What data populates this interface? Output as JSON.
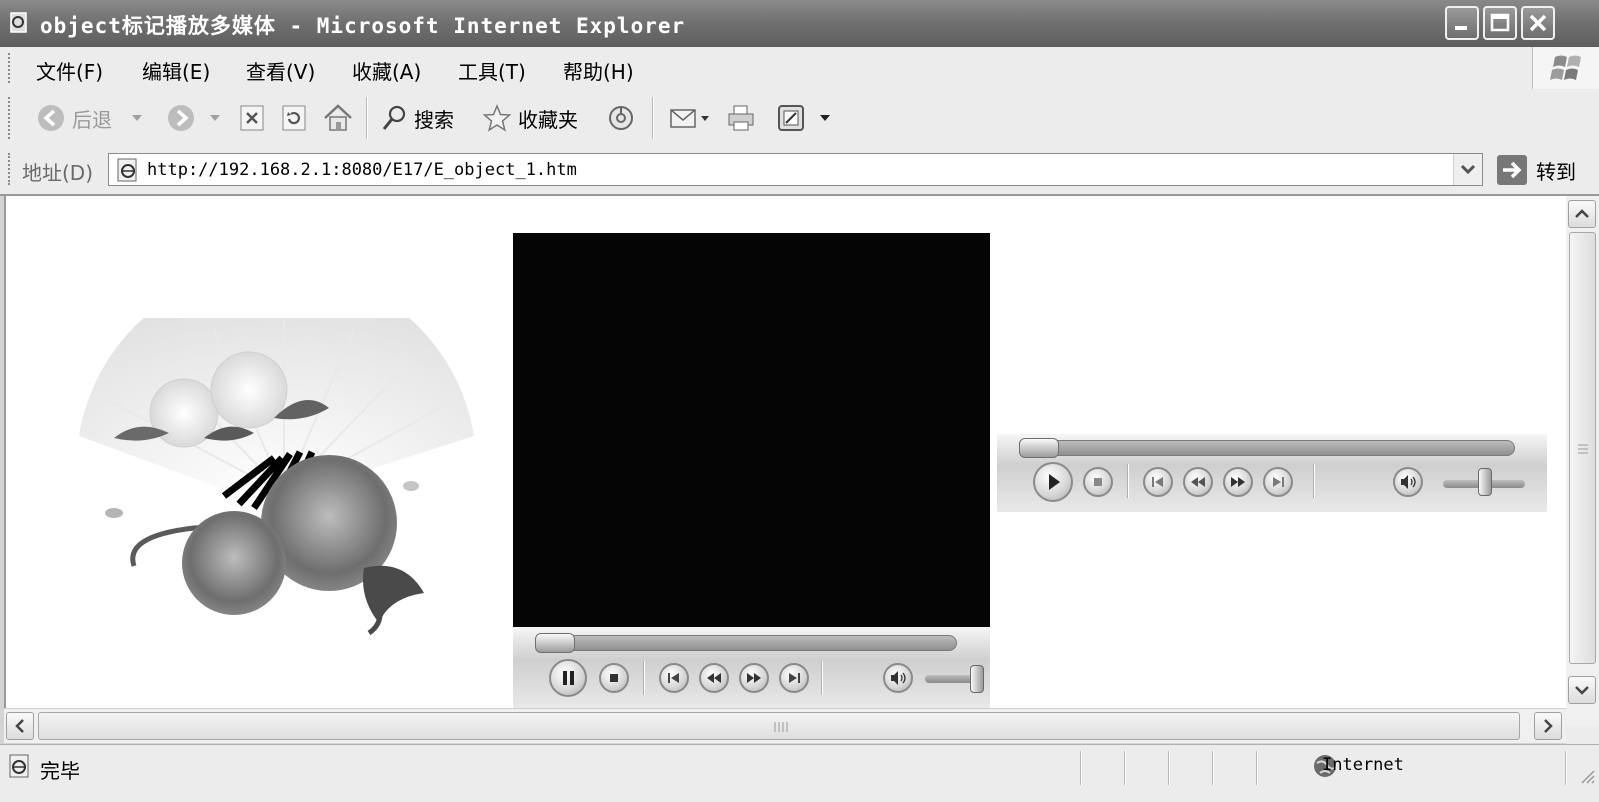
{
  "window": {
    "title": "object标记播放多媒体 - Microsoft Internet Explorer",
    "controls": [
      "minimize",
      "maximize",
      "close"
    ]
  },
  "menu": {
    "items": [
      {
        "label": "文件(F)"
      },
      {
        "label": "编辑(E)"
      },
      {
        "label": "查看(V)"
      },
      {
        "label": "收藏(A)"
      },
      {
        "label": "工具(T)"
      },
      {
        "label": "帮助(H)"
      }
    ]
  },
  "toolbar": {
    "back_label": "后退",
    "search_label": "搜索",
    "favorites_label": "收藏夹"
  },
  "address": {
    "label": "地址(D)",
    "url": "http://192.168.2.1:8080/E17/E_object_1.htm",
    "go_label": "转到"
  },
  "status": {
    "text": "完毕",
    "zone": "Internet"
  },
  "players": [
    {
      "state": "playing",
      "has_video_area": true,
      "seek_position": 0.02,
      "volume": 1.0
    },
    {
      "state": "stopped",
      "has_video_area": false,
      "seek_position": 0.02,
      "volume": 0.55
    }
  ],
  "colors": {
    "titlebar": "#6f6f6f",
    "video_background": "#050505",
    "page_background": "#ffffff"
  }
}
